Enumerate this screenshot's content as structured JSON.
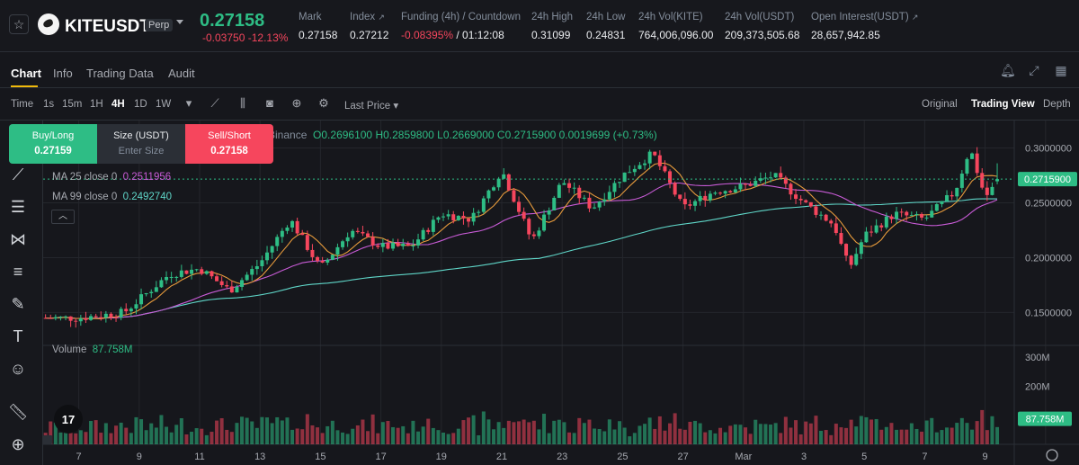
{
  "header": {
    "symbol": "KITEUSDT",
    "contract_type": "Perp",
    "last_price": "0.27158",
    "change": "-0.03750",
    "change_pct": "-12.13%",
    "stats": [
      {
        "label": "Mark",
        "value": "0.27158"
      },
      {
        "label": "Index",
        "value": "0.27212"
      },
      {
        "label": "Funding (4h) / Countdown",
        "value_red": "-0.08395%",
        "value": " / 01:12:08"
      },
      {
        "label": "24h High",
        "value": "0.31099"
      },
      {
        "label": "24h Low",
        "value": "0.24831"
      },
      {
        "label": "24h Vol(KITE)",
        "value": "764,006,096.00"
      },
      {
        "label": "24h Vol(USDT)",
        "value": "209,373,505.68"
      },
      {
        "label": "Open Interest(USDT)",
        "value": "28,657,942.85"
      }
    ]
  },
  "tabs": [
    "Chart",
    "Info",
    "Trading Data",
    "Audit"
  ],
  "toolbar": {
    "time_label": "Time",
    "intervals": [
      "1s",
      "15m",
      "1H",
      "4H",
      "1D",
      "1W"
    ],
    "active_interval": "4H",
    "price_type": "Last Price",
    "views": [
      "Original",
      "Trading View",
      "Depth"
    ],
    "active_view": "Trading View"
  },
  "order_panel": {
    "buy_label": "Buy/Long",
    "buy_price": "0.27159",
    "size_label": "Size (USDT)",
    "size_placeholder": "Enter Size",
    "sell_label": "Sell/Short",
    "sell_price": "0.27158"
  },
  "legend": {
    "exchange": "Binance",
    "ohlc": "O0.2696100 H0.2859800 L0.2669000 C0.2715900 0.0019699 (+0.73%)",
    "ma25_label": "MA 25 close 0",
    "ma25_value": "0.2511956",
    "ma99_label": "MA 99 close 0",
    "ma99_value": "0.2492740",
    "volume_label": "Volume",
    "volume_value": "87.758M"
  },
  "colors": {
    "up": "#2ebd85",
    "down": "#f6465d",
    "ma25": "#e79b3c",
    "ma7": "#c85bd6",
    "ma99": "#5fd6c8",
    "accent": "#f0b90b"
  },
  "chart_data": {
    "type": "candlestick",
    "price_axis_ticks": [
      "0.3000000",
      "0.2500000",
      "0.2000000",
      "0.1500000"
    ],
    "price_range": [
      0.12,
      0.325
    ],
    "current_price_label": "0.2715900",
    "volume_axis_ticks": [
      "300M",
      "200M"
    ],
    "volume_range": [
      0,
      340
    ],
    "current_volume_label": "87.758M",
    "date_ticks": [
      "7",
      "9",
      "11",
      "13",
      "15",
      "17",
      "19",
      "21",
      "23",
      "25",
      "27",
      "Mar",
      "3",
      "5",
      "7",
      "9"
    ],
    "date_ticks_extra": "",
    "key_points": [
      {
        "day": 7,
        "price": 0.145
      },
      {
        "day": 8.5,
        "price": 0.15
      },
      {
        "day": 10,
        "price": 0.185
      },
      {
        "day": 11,
        "price": 0.19
      },
      {
        "day": 12,
        "price": 0.17
      },
      {
        "day": 13,
        "price": 0.195
      },
      {
        "day": 14,
        "price": 0.235
      },
      {
        "day": 15,
        "price": 0.19
      },
      {
        "day": 16,
        "price": 0.225
      },
      {
        "day": 17,
        "price": 0.21
      },
      {
        "day": 18,
        "price": 0.21
      },
      {
        "day": 19,
        "price": 0.24
      },
      {
        "day": 20,
        "price": 0.235
      },
      {
        "day": 21,
        "price": 0.28
      },
      {
        "day": 22,
        "price": 0.215
      },
      {
        "day": 23,
        "price": 0.27
      },
      {
        "day": 24,
        "price": 0.245
      },
      {
        "day": 25,
        "price": 0.275
      },
      {
        "day": 26,
        "price": 0.295
      },
      {
        "day": 27,
        "price": 0.245
      },
      {
        "day": 28,
        "price": 0.26
      },
      {
        "day": 29,
        "price": 0.265
      },
      {
        "day": 30,
        "price": 0.275
      },
      {
        "day": 31,
        "price": 0.25
      },
      {
        "day": 32,
        "price": 0.23
      },
      {
        "day": 32.5,
        "price": 0.19
      },
      {
        "day": 33,
        "price": 0.22
      },
      {
        "day": 34,
        "price": 0.24
      },
      {
        "day": 35,
        "price": 0.235
      },
      {
        "day": 36,
        "price": 0.26
      },
      {
        "day": 36.5,
        "price": 0.3
      },
      {
        "day": 37,
        "price": 0.255
      },
      {
        "day": 37.5,
        "price": 0.2716
      }
    ]
  }
}
